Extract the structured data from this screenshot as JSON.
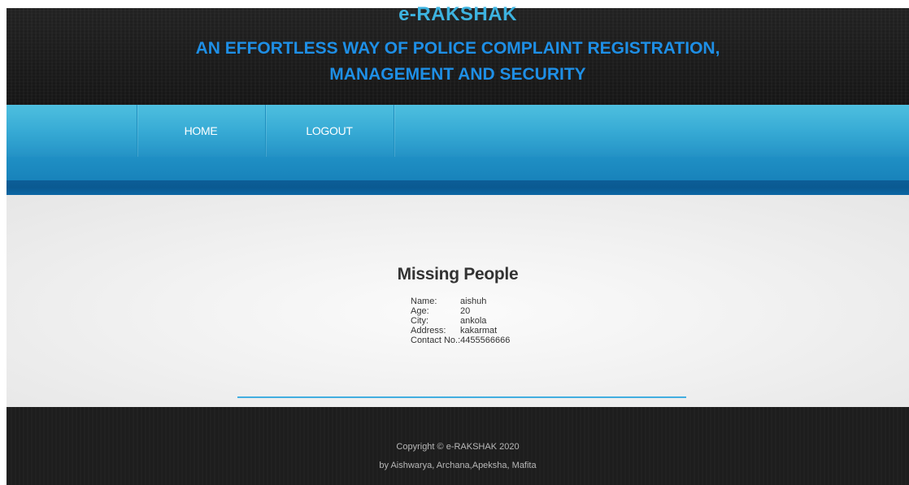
{
  "header": {
    "title": "e-RAKSHAK",
    "tagline_line1": "AN EFFORTLESS WAY OF POLICE COMPLAINT REGISTRATION,",
    "tagline_line2": "MANAGEMENT AND SECURITY"
  },
  "nav": {
    "items": [
      {
        "label": "HOME"
      },
      {
        "label": "LOGOUT"
      }
    ]
  },
  "main": {
    "title": "Missing People",
    "person": {
      "name_label": "Name:",
      "name_value": "aishuh",
      "age_label": "Age:",
      "age_value": "20",
      "city_label": "City:",
      "city_value": "ankola",
      "address_label": "Address:",
      "address_value": "kakarmat",
      "contact_label": "Contact No.:",
      "contact_value": "4455566666"
    }
  },
  "footer": {
    "copyright": "Copyright © e-RAKSHAK 2020",
    "credits": "by Aishwarya, Archana,Apeksha, Mafita"
  },
  "colors": {
    "title": "#3db3e0",
    "tagline": "#1e8fe6",
    "nav_bg": "#2aa5d2",
    "band": "#0c5e97",
    "divider": "#42aee0",
    "footer_bg": "#1d1d1d"
  }
}
